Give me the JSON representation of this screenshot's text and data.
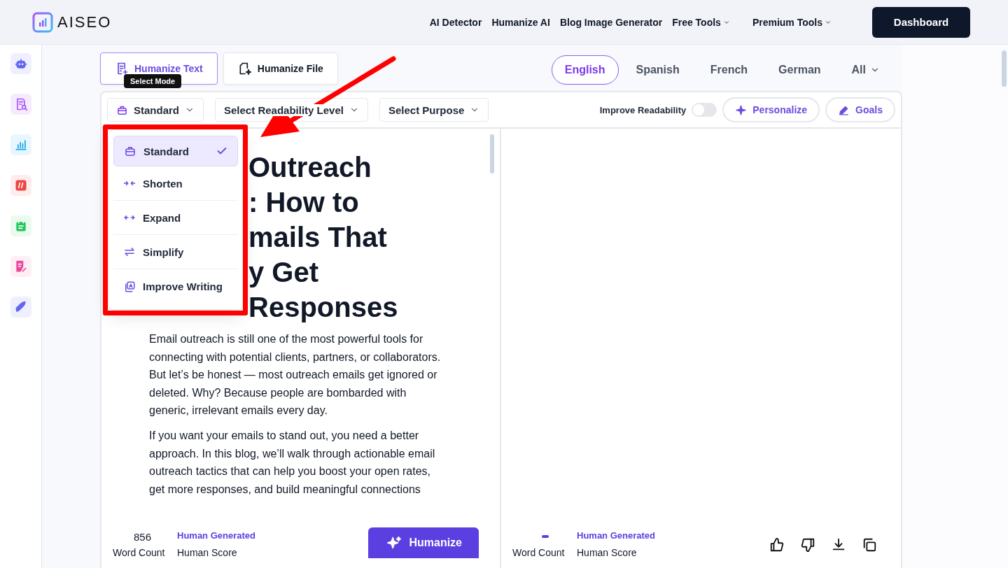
{
  "header": {
    "logo": "AISEO",
    "nav": [
      {
        "label": "AI Detector",
        "dropdown": false
      },
      {
        "label": "Humanize AI",
        "dropdown": false
      },
      {
        "label": "Blog Image Generator",
        "dropdown": false
      },
      {
        "label": "Free Tools",
        "dropdown": true
      },
      {
        "label": "Premium Tools",
        "dropdown": true
      }
    ],
    "dashboard_button": "Dashboard"
  },
  "mode_tabs": [
    {
      "label": "Humanize Text",
      "selected": true
    },
    {
      "label": "Humanize File",
      "selected": false
    }
  ],
  "languages": [
    {
      "label": "English",
      "selected": true
    },
    {
      "label": "Spanish",
      "selected": false
    },
    {
      "label": "French",
      "selected": false
    },
    {
      "label": "German",
      "selected": false
    },
    {
      "label": "All",
      "selected": false,
      "dropdown": true
    }
  ],
  "tooltip": "Select Mode",
  "toolbar": {
    "mode_select": "Standard",
    "readability_select": "Select Readability Level",
    "purpose_select": "Select Purpose",
    "toggle": {
      "label": "Improve Readability",
      "on": false
    },
    "buttons": [
      "Personalize",
      "Goals"
    ]
  },
  "mode_menu": [
    {
      "label": "Standard",
      "selected": true
    },
    {
      "label": "Shorten",
      "selected": false
    },
    {
      "label": "Expand",
      "selected": false
    },
    {
      "label": "Simplify",
      "selected": false
    },
    {
      "label": "Improve Writing",
      "selected": false
    }
  ],
  "input": {
    "heading_lines": [
      "Outreach",
      ": How to",
      "mails That",
      "y Get",
      "Responses"
    ],
    "paragraphs": [
      "Email outreach is still one of the most powerful tools for connecting with potential clients, partners, or collaborators. But let’s be honest — most outreach emails get ignored or deleted. Why? Because people are bombarded with generic, irrelevant emails every day.",
      "If you want your emails to stand out, you need a better approach. In this blog, we’ll walk through actionable email outreach tactics that can help you boost your open rates, get more responses, and build meaningful connections"
    ],
    "word_count": "856",
    "word_count_label": "Word Count",
    "score": "Human Generated",
    "score_label": "Human Score",
    "button": "Humanize"
  },
  "output": {
    "score": "Human Generated",
    "word_count_label": "Word Count",
    "score_label": "Human Score"
  }
}
